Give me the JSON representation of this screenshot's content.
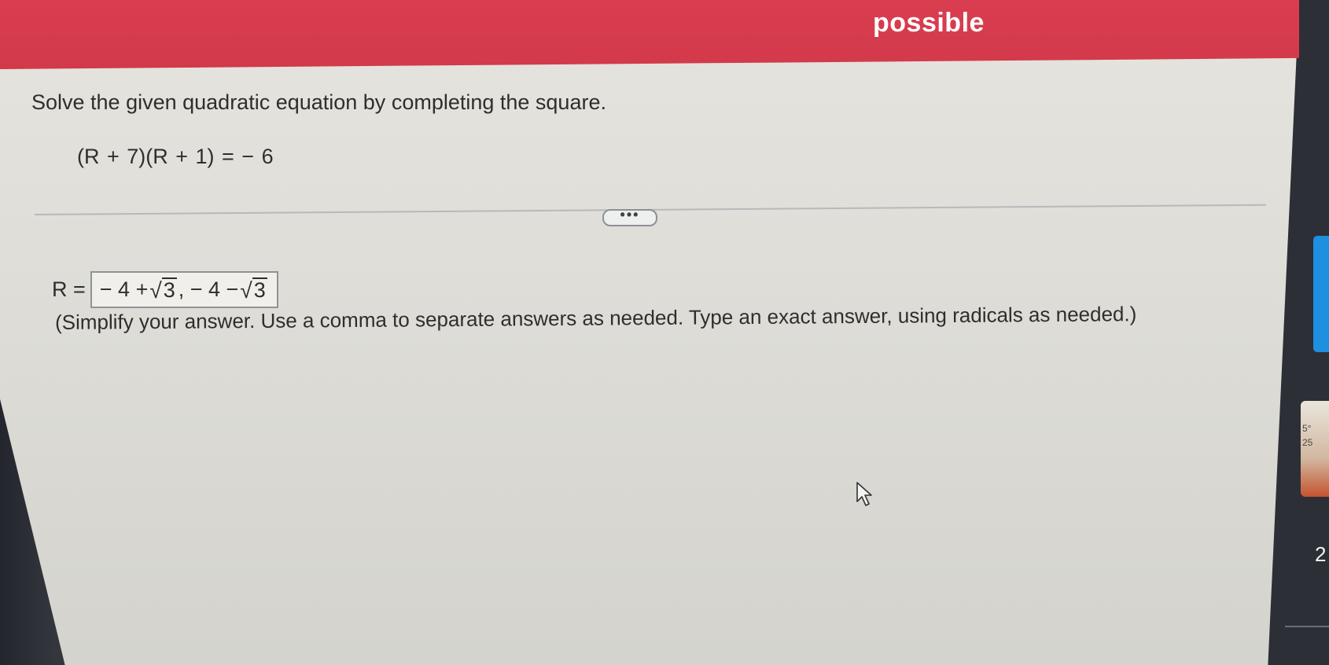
{
  "header": {
    "title": "possible",
    "accent_color": "#d93e50"
  },
  "question": {
    "instruction": "Solve the given quadratic equation by completing the square.",
    "equation": "(R + 7)(R + 1) = − 6"
  },
  "divider": {
    "more_label": "•••"
  },
  "answer": {
    "label": "R =",
    "part1_prefix": "− 4 +",
    "part1_radicand": "3",
    "separator": ", − 4 −",
    "part2_radicand": "3",
    "hint": "(Simplify your answer. Use a comma to separate answers as needed. Type an exact answer, using radicals as needed.)"
  },
  "edge": {
    "widget_text_1": "5°",
    "widget_text_2": "25",
    "number": "2"
  }
}
